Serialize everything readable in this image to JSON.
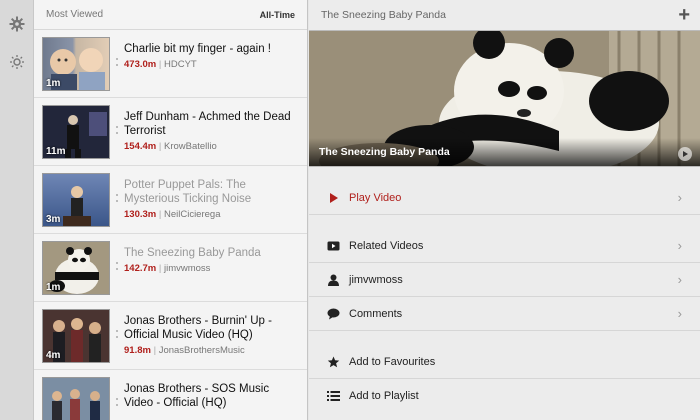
{
  "sidebar": {
    "icons": [
      "gear-icon",
      "brightness-icon"
    ]
  },
  "list": {
    "title": "Most Viewed",
    "filter": "All-Time",
    "items": [
      {
        "title": "Charlie bit my finger - again !",
        "views": "473.0m",
        "channel": "HDCYT",
        "duration": "1m",
        "dimmed": false
      },
      {
        "title": "Jeff Dunham - Achmed the Dead Terrorist",
        "views": "154.4m",
        "channel": "KrowBatellio",
        "duration": "11m",
        "dimmed": false
      },
      {
        "title": "Potter Puppet Pals: The Mysterious Ticking Noise",
        "views": "130.3m",
        "channel": "NeilCicierega",
        "duration": "3m",
        "dimmed": true
      },
      {
        "title": "The Sneezing Baby Panda",
        "views": "142.7m",
        "channel": "jimvwmoss",
        "duration": "1m",
        "dimmed": true
      },
      {
        "title": "Jonas Brothers - Burnin' Up - Official Music Video (HQ)",
        "views": "91.8m",
        "channel": "JonasBrothersMusic",
        "duration": "4m",
        "dimmed": false
      },
      {
        "title": "Jonas Brothers - SOS Music Video - Official (HQ)",
        "views": "",
        "channel": "",
        "duration": "",
        "dimmed": false
      }
    ]
  },
  "detail": {
    "title": "The Sneezing Baby Panda",
    "add_icon": "plus-icon",
    "caption": "The Sneezing Baby Panda",
    "menu": {
      "play": "Play Video",
      "related": "Related Videos",
      "user": "jimvwmoss",
      "comments": "Comments",
      "favourites": "Add to Favourites",
      "playlist": "Add to Playlist"
    }
  },
  "colors": {
    "accent": "#b0201c"
  }
}
